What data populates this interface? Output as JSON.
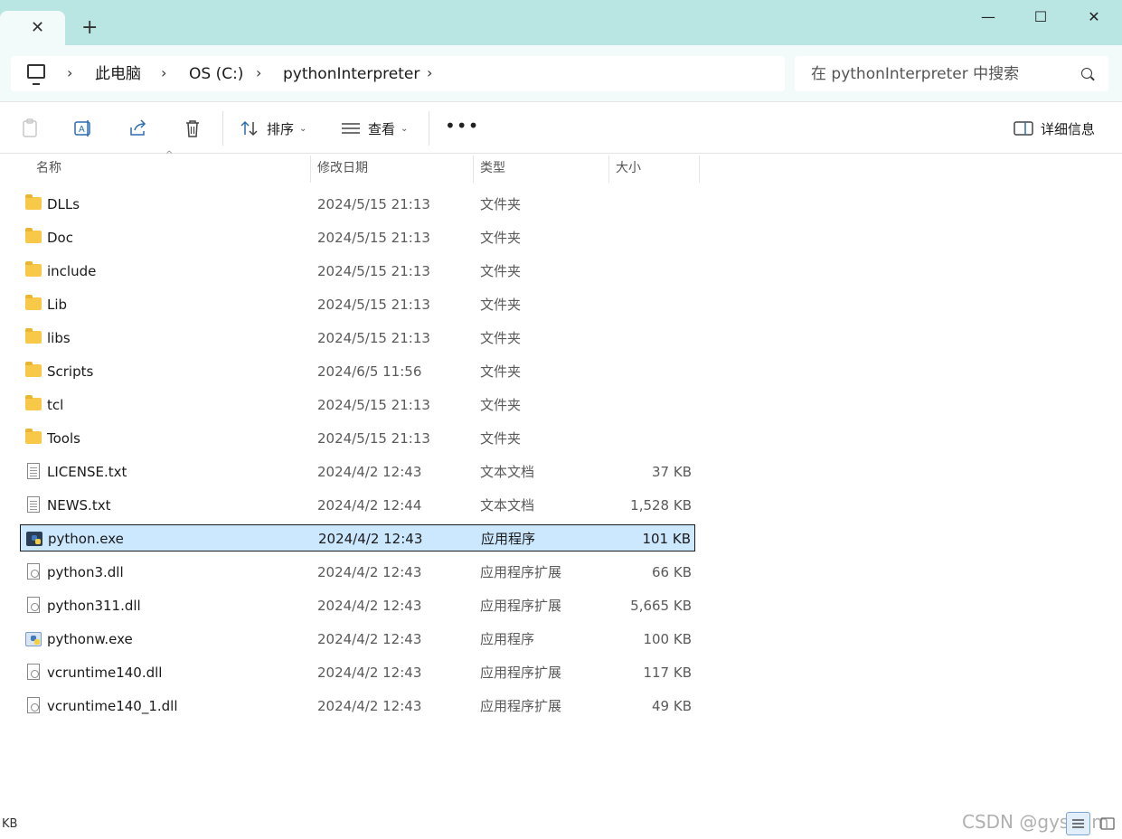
{
  "window": {
    "tab_close": "✕",
    "new_tab": "+",
    "minimize": "—",
    "maximize": "☐",
    "close": "✕"
  },
  "address": {
    "crumbs": [
      "此电脑",
      "OS (C:)",
      "pythonInterpreter"
    ],
    "search_placeholder": "在 pythonInterpreter 中搜索"
  },
  "toolbar": {
    "sort_label": "排序",
    "view_label": "查看",
    "more_label": "•••",
    "details_label": "详细信息"
  },
  "columns": {
    "name": "名称",
    "date": "修改日期",
    "type": "类型",
    "size": "大小"
  },
  "files": [
    {
      "name": "DLLs",
      "date": "2024/5/15 21:13",
      "type": "文件夹",
      "size": "",
      "icon": "folder-icon"
    },
    {
      "name": "Doc",
      "date": "2024/5/15 21:13",
      "type": "文件夹",
      "size": "",
      "icon": "folder-icon"
    },
    {
      "name": "include",
      "date": "2024/5/15 21:13",
      "type": "文件夹",
      "size": "",
      "icon": "folder-icon"
    },
    {
      "name": "Lib",
      "date": "2024/5/15 21:13",
      "type": "文件夹",
      "size": "",
      "icon": "folder-icon"
    },
    {
      "name": "libs",
      "date": "2024/5/15 21:13",
      "type": "文件夹",
      "size": "",
      "icon": "folder-icon"
    },
    {
      "name": "Scripts",
      "date": "2024/6/5 11:56",
      "type": "文件夹",
      "size": "",
      "icon": "folder-icon"
    },
    {
      "name": "tcl",
      "date": "2024/5/15 21:13",
      "type": "文件夹",
      "size": "",
      "icon": "folder-icon"
    },
    {
      "name": "Tools",
      "date": "2024/5/15 21:13",
      "type": "文件夹",
      "size": "",
      "icon": "folder-icon"
    },
    {
      "name": "LICENSE.txt",
      "date": "2024/4/2 12:43",
      "type": "文本文档",
      "size": "37 KB",
      "icon": "text-file-icon"
    },
    {
      "name": "NEWS.txt",
      "date": "2024/4/2 12:44",
      "type": "文本文档",
      "size": "1,528 KB",
      "icon": "text-file-icon"
    },
    {
      "name": "python.exe",
      "date": "2024/4/2 12:43",
      "type": "应用程序",
      "size": "101 KB",
      "icon": "python-exe-icon",
      "selected": true
    },
    {
      "name": "python3.dll",
      "date": "2024/4/2 12:43",
      "type": "应用程序扩展",
      "size": "66 KB",
      "icon": "dll-file-icon"
    },
    {
      "name": "python311.dll",
      "date": "2024/4/2 12:43",
      "type": "应用程序扩展",
      "size": "5,665 KB",
      "icon": "dll-file-icon"
    },
    {
      "name": "pythonw.exe",
      "date": "2024/4/2 12:43",
      "type": "应用程序",
      "size": "100 KB",
      "icon": "pythonw-exe-icon"
    },
    {
      "name": "vcruntime140.dll",
      "date": "2024/4/2 12:43",
      "type": "应用程序扩展",
      "size": "117 KB",
      "icon": "dll-file-icon"
    },
    {
      "name": "vcruntime140_1.dll",
      "date": "2024/4/2 12:43",
      "type": "应用程序扩展",
      "size": "49 KB",
      "icon": "dll-file-icon"
    }
  ],
  "status": {
    "left_text": "KB"
  },
  "watermark": "CSDN @gysenm"
}
